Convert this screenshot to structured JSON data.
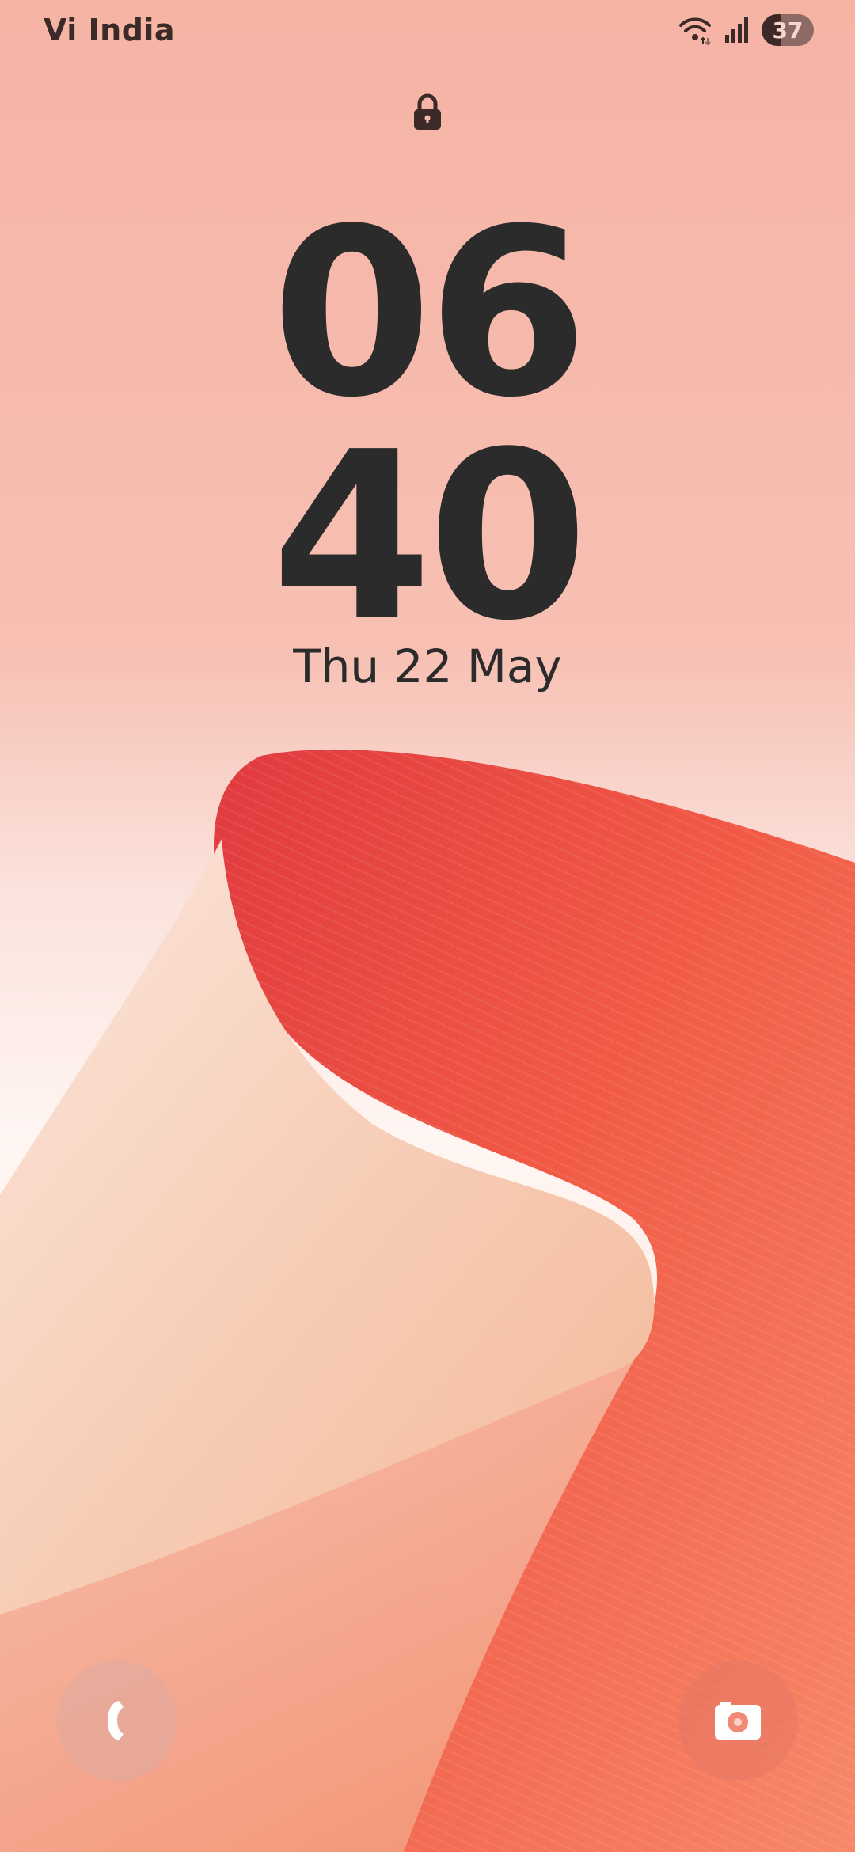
{
  "status_bar": {
    "carrier": "Vi India",
    "battery_percent": "37",
    "battery_level": 0.37,
    "icons": [
      "wifi-icon",
      "signal-icon",
      "battery-icon"
    ]
  },
  "lock_screen": {
    "lock_icon": "lock-icon",
    "hours": "06",
    "minutes": "40",
    "date": "Thu 22 May"
  },
  "shortcuts": {
    "left": "phone-icon",
    "right": "camera-icon"
  },
  "colors": {
    "clock_text": "#2b2b2b",
    "wallpaper_red": "#e94b43",
    "wallpaper_peach": "#f8d2bf"
  }
}
